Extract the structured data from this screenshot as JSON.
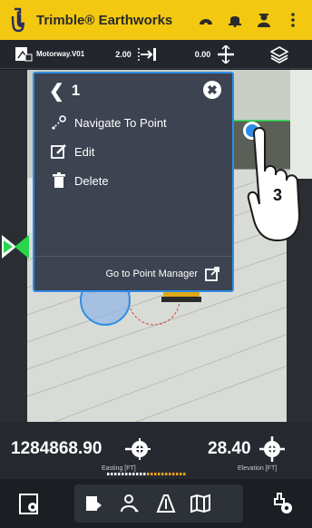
{
  "app": {
    "title": "Trimble® Earthworks"
  },
  "info_bar": {
    "design_name": "Motorway.V01",
    "offset_value": "2.00",
    "vertical_offset_value": "0.00"
  },
  "popup": {
    "title": "1",
    "items": [
      {
        "label": "Navigate To Point",
        "icon": "navigate-point-icon"
      },
      {
        "label": "Edit",
        "icon": "edit-icon"
      },
      {
        "label": "Delete",
        "icon": "trash-icon"
      }
    ],
    "footer_label": "Go to Point Manager"
  },
  "annotation": {
    "step": "3"
  },
  "readout": {
    "easting": "1284868.90",
    "easting_label": "Easting [FT]",
    "elevation": "28.40",
    "elevation_label": "Elevation [FT]",
    "progress_fraction": 0.5
  },
  "colors": {
    "brand_yellow": "#f2c811",
    "accent_blue": "#2e8de6",
    "accent_green": "#27d64b",
    "progress_orange": "#f2a31a"
  }
}
